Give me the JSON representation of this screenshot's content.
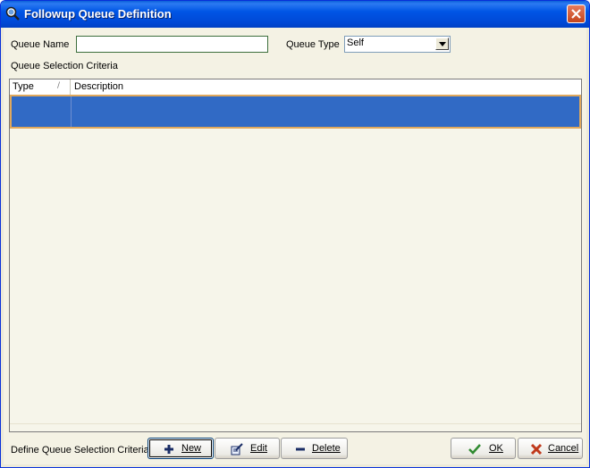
{
  "window": {
    "title": "Followup Queue Definition"
  },
  "form": {
    "queue_name_label": "Queue Name",
    "queue_name_value": "",
    "queue_type_label": "Queue Type",
    "queue_type_value": "Self",
    "criteria_label": "Queue Selection Criteria"
  },
  "grid": {
    "columns": [
      "Type",
      "Description"
    ],
    "sort_indicator": "/",
    "rows": [
      {
        "type": "",
        "description": ""
      }
    ]
  },
  "footer": {
    "define_label": "Define Queue Selection Criteria",
    "new_label": "New",
    "edit_label": "Edit",
    "delete_label": "Delete",
    "ok_label": "OK",
    "cancel_label": "Cancel"
  },
  "colors": {
    "title_bar": "#0055e5",
    "selection": "#316ac5",
    "selection_border": "#e0a85c",
    "ok_check": "#2f8a2f",
    "cancel_x": "#c0391b"
  }
}
